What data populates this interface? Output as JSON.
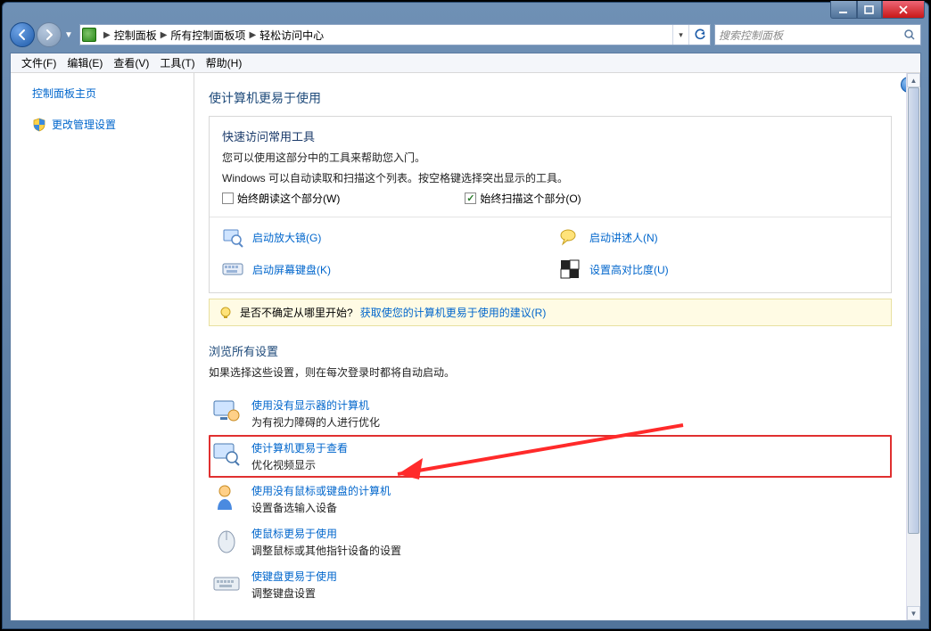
{
  "breadcrumbs": [
    "控制面板",
    "所有控制面板项",
    "轻松访问中心"
  ],
  "search_placeholder": "搜索控制面板",
  "menu": [
    "文件(F)",
    "编辑(E)",
    "查看(V)",
    "工具(T)",
    "帮助(H)"
  ],
  "sidebar": {
    "home": "控制面板主页",
    "admin": "更改管理设置"
  },
  "page_title": "使计算机更易于使用",
  "quick": {
    "heading": "快速访问常用工具",
    "line1": "您可以使用这部分中的工具来帮助您入门。",
    "line2": "Windows 可以自动读取和扫描这个列表。按空格键选择突出显示的工具。",
    "chk_read": "始终朗读这个部分(W)",
    "chk_scan": "始终扫描这个部分(O)",
    "tools": {
      "magnifier": "启动放大镜(G)",
      "narrator": "启动讲述人(N)",
      "osk": "启动屏幕键盘(K)",
      "contrast": "设置高对比度(U)"
    }
  },
  "hint": {
    "prefix": "是否不确定从哪里开始?",
    "link": "获取使您的计算机更易于使用的建议(R)"
  },
  "browse": {
    "heading": "浏览所有设置",
    "sub": "如果选择这些设置，则在每次登录时都将自动启动。",
    "items": [
      {
        "title": "使用没有显示器的计算机",
        "desc": "为有视力障碍的人进行优化"
      },
      {
        "title": "使计算机更易于查看",
        "desc": "优化视频显示"
      },
      {
        "title": "使用没有鼠标或键盘的计算机",
        "desc": "设置备选输入设备"
      },
      {
        "title": "使鼠标更易于使用",
        "desc": "调整鼠标或其他指针设备的设置"
      },
      {
        "title": "使键盘更易于使用",
        "desc": "调整键盘设置"
      }
    ]
  }
}
